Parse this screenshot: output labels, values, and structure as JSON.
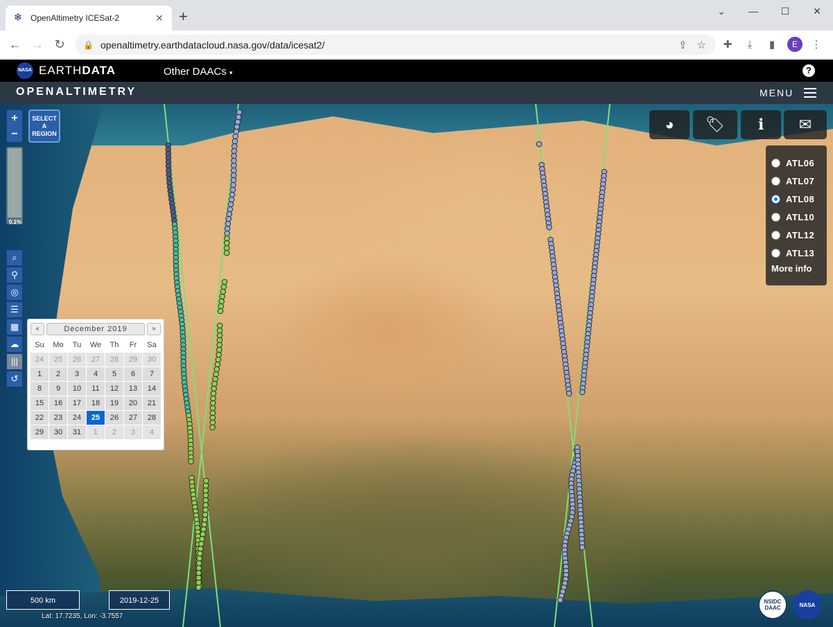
{
  "browser": {
    "tab_title": "OpenAltimetry ICESat-2",
    "url": "openaltimetry.earthdatacloud.nasa.gov/data/icesat2/",
    "profile_initial": "E"
  },
  "earthdata": {
    "brand_light": "EARTH",
    "brand_bold": "DATA",
    "nasa_logo": "NASA",
    "other_daacs": "Other DAACs",
    "help_glyph": "?"
  },
  "openaltimetry": {
    "title": "OPENALTIMETRY",
    "menu_label": "MENU"
  },
  "map_controls": {
    "select_region": "SELECT A REGION",
    "opacity_label": "0.1%",
    "tools": [
      "search-icon",
      "marker-icon",
      "target-icon",
      "list-icon",
      "calendar-icon",
      "cloud-icon",
      "barcode-icon",
      "reset-icon"
    ]
  },
  "calendar": {
    "month": "December 2019",
    "prev": "«",
    "next": "»",
    "weekdays": [
      "Su",
      "Mo",
      "Tu",
      "We",
      "Th",
      "Fr",
      "Sa"
    ],
    "weeks": [
      [
        "24",
        "25",
        "26",
        "27",
        "28",
        "29",
        "30"
      ],
      [
        "1",
        "2",
        "3",
        "4",
        "5",
        "6",
        "7"
      ],
      [
        "8",
        "9",
        "10",
        "11",
        "12",
        "13",
        "14"
      ],
      [
        "15",
        "16",
        "17",
        "18",
        "19",
        "20",
        "21"
      ],
      [
        "22",
        "23",
        "24",
        "25",
        "26",
        "27",
        "28"
      ],
      [
        "29",
        "30",
        "31",
        "1",
        "2",
        "3",
        "4"
      ]
    ],
    "selected_day": "25"
  },
  "products": {
    "items": [
      "ATL06",
      "ATL07",
      "ATL08",
      "ATL10",
      "ATL12",
      "ATL13"
    ],
    "selected": "ATL08",
    "more_info": "More info"
  },
  "status": {
    "scale": "500 km",
    "date": "2019-12-25",
    "latlon": "Lat: 17.7235, Lon: -3.7557"
  },
  "logos": {
    "nsidc": "NSIDC DAAC",
    "nasa": "NASA"
  },
  "colors": {
    "track_line": "#7ee07a",
    "point_blue": "#98a8d8",
    "point_green": "#8fd14f",
    "point_teal": "#3fbf9f",
    "accent": "#2a5fa8",
    "selected_day": "#0a67c8"
  }
}
